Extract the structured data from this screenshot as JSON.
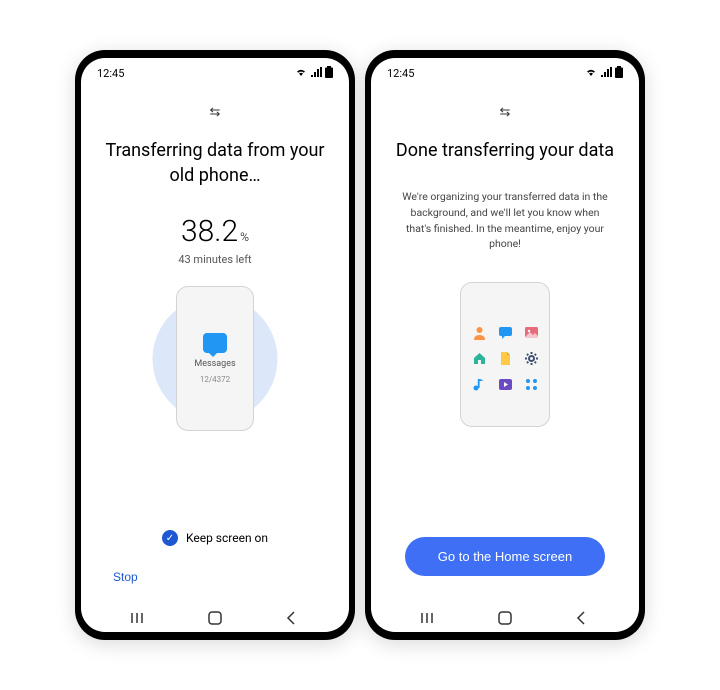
{
  "statusBar": {
    "time": "12:45"
  },
  "left": {
    "title": "Transferring data from your old phone…",
    "percentValue": "38.2",
    "percentUnit": "%",
    "timeLeft": "43 minutes left",
    "itemLabel": "Messages",
    "itemCount": "12/4372",
    "keepScreenLabel": "Keep screen on",
    "stopLabel": "Stop"
  },
  "right": {
    "title": "Done transferring your data",
    "subtitle": "We're organizing your transferred data in the background, and we'll let you know when that's finished. In the meantime, enjoy your phone!",
    "homeButton": "Go to the Home screen"
  }
}
